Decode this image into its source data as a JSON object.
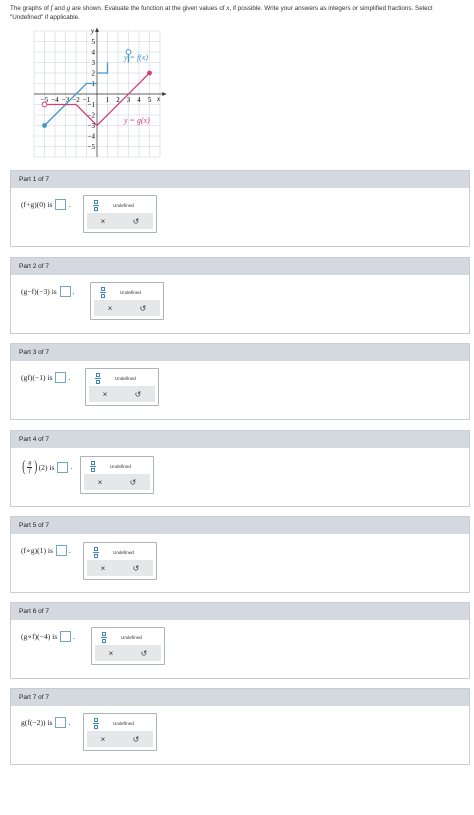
{
  "instructions": {
    "p1": "The graphs of ",
    "f": "f",
    "p2": " and ",
    "g": "g",
    "p3": " are shown. Evaluate the function at the given values of ",
    "x": "x",
    "p4": ", if possible. Write your answers as integers or simplified fractions. Select \"Undefined\" if applicable."
  },
  "graph": {
    "y_axis_label": "y",
    "x_axis_label": "x",
    "f_label": "y = f(x)",
    "g_label": "y = g(x)",
    "x_ticks": [
      "−5",
      "−4",
      "−3",
      "−2",
      "−1",
      "1",
      "2",
      "3",
      "4",
      "5"
    ],
    "y_ticks": [
      "5",
      "4",
      "3",
      "2",
      "1",
      "−1",
      "−2",
      "−3",
      "−4",
      "−5"
    ],
    "f_color": "#3d97cf",
    "g_color": "#d23f76",
    "f_points": [
      [
        -5,
        -3
      ],
      [
        -1,
        1
      ],
      [
        0,
        1
      ],
      [
        0,
        2
      ],
      [
        1,
        2
      ],
      [
        1,
        3
      ],
      [
        3,
        3
      ],
      [
        3,
        4
      ]
    ],
    "g_points": [
      [
        -5,
        -1
      ],
      [
        -2,
        -1
      ],
      [
        0,
        -3
      ],
      [
        5,
        2
      ]
    ]
  },
  "parts": [
    {
      "header": "Part 1 of 7",
      "expr": "(f+g)(0) is",
      "undefined": "Undefined",
      "clear": "×",
      "undo": "↺"
    },
    {
      "header": "Part 2 of 7",
      "expr": "(g−f)(−3) is",
      "undefined": "Undefined",
      "clear": "×",
      "undo": "↺"
    },
    {
      "header": "Part 3 of 7",
      "expr": "(gf)(−1) is",
      "undefined": "Undefined",
      "clear": "×",
      "undo": "↺"
    },
    {
      "header": "Part 4 of 7",
      "expr": "(2) is",
      "frac_num": "g",
      "frac_den": "f",
      "undefined": "Undefined",
      "clear": "×",
      "undo": "↺"
    },
    {
      "header": "Part 5 of 7",
      "expr": "(f∘g)(1) is",
      "undefined": "Undefined",
      "clear": "×",
      "undo": "↺"
    },
    {
      "header": "Part 6 of 7",
      "expr": "(g∘f)(−4) is",
      "undefined": "Undefined",
      "clear": "×",
      "undo": "↺"
    },
    {
      "header": "Part 7 of 7",
      "expr": "g(f(−2)) is",
      "undefined": "Undefined",
      "clear": "×",
      "undo": "↺"
    }
  ]
}
